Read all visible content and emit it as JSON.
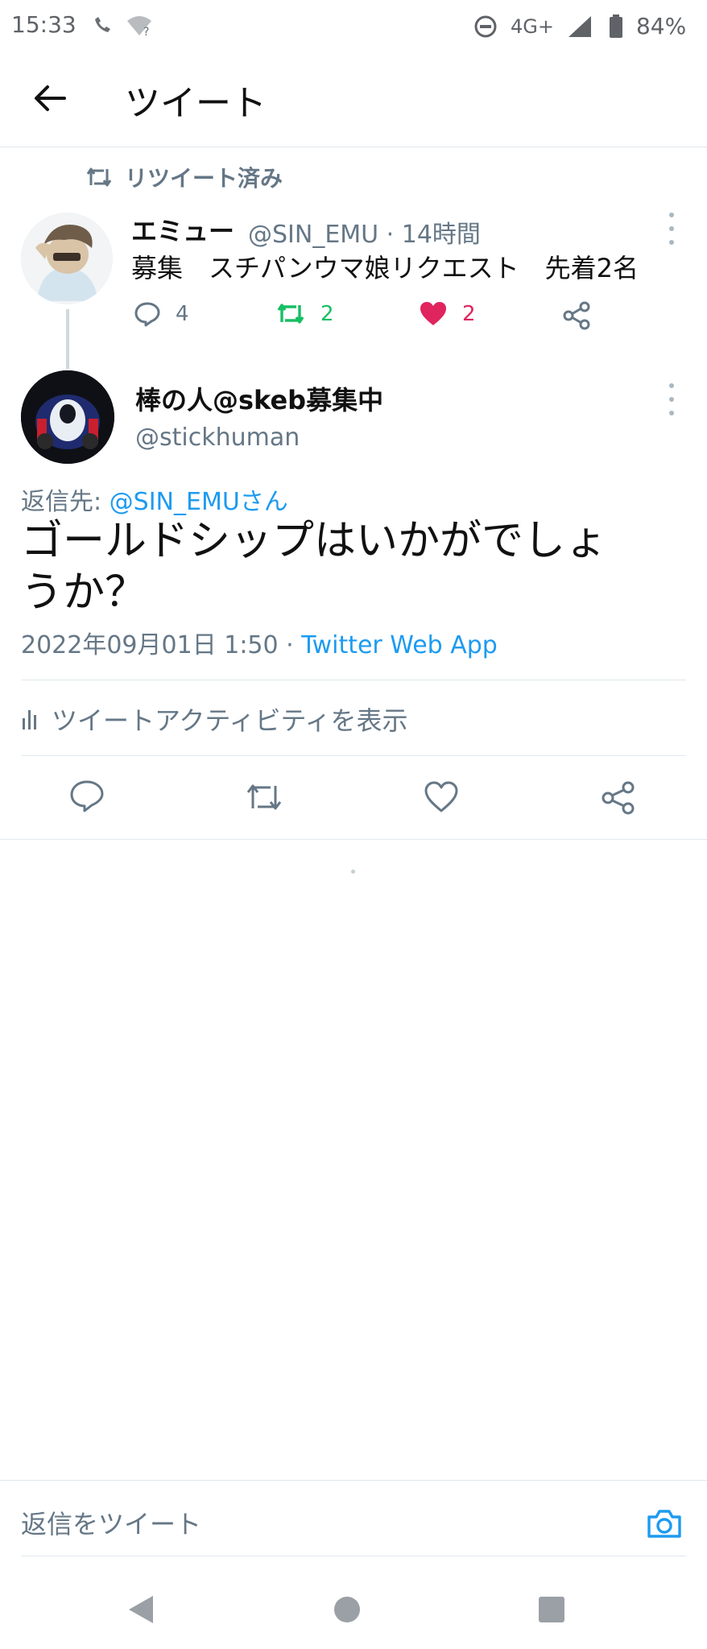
{
  "status_bar": {
    "time": "15:33",
    "network": "4G+",
    "battery": "84%"
  },
  "app_bar": {
    "title": "ツイート"
  },
  "retweet_banner": {
    "label": "リツイート済み"
  },
  "parent_tweet": {
    "display_name": "エミュー",
    "handle_time": "@SIN_EMU · 14時間",
    "text": "募集　スチパンウマ娘リクエスト　先着2名",
    "reply_count": "4",
    "retweet_count": "2",
    "like_count": "2"
  },
  "main_tweet": {
    "display_name": "棒の人@skeb募集中",
    "handle": "@stickhuman",
    "reply_to_label": "返信先: ",
    "reply_to_handle": "@SIN_EMUさん",
    "text": "ゴールドシップはいかがでしょうか？",
    "date": "2022年09月01日 1:50 · ",
    "source": "Twitter Web App",
    "activity_label": "ツイートアクティビティを表示"
  },
  "reply_input": {
    "placeholder": "返信をツイート"
  },
  "colors": {
    "accent": "#1d9bf0",
    "retweet_green": "#17bf63",
    "like_pink": "#e0245e",
    "muted": "#657786"
  }
}
